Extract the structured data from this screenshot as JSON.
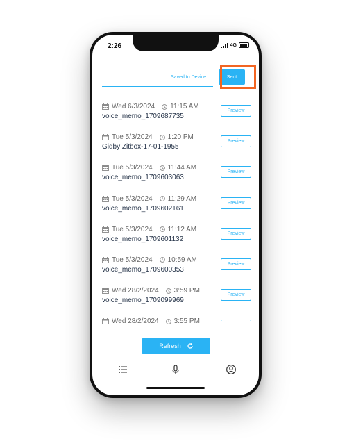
{
  "status": {
    "time": "2:26",
    "network": "4G"
  },
  "tabs": {
    "saved_label": "Saved to Device",
    "sent_label": "Sent"
  },
  "items": [
    {
      "date": "Wed 6/3/2024",
      "time": "11:15 AM",
      "name": "voice_memo_1709687735",
      "preview_label": "Preview"
    },
    {
      "date": "Tue 5/3/2024",
      "time": "1:20 PM",
      "name": "Gidby Zitbox-17-01-1955",
      "preview_label": "Preview"
    },
    {
      "date": "Tue 5/3/2024",
      "time": "11:44 AM",
      "name": "voice_memo_1709603063",
      "preview_label": "Preview"
    },
    {
      "date": "Tue 5/3/2024",
      "time": "11:29 AM",
      "name": "voice_memo_1709602161",
      "preview_label": "Preview"
    },
    {
      "date": "Tue 5/3/2024",
      "time": "11:12 AM",
      "name": "voice_memo_1709601132",
      "preview_label": "Preview"
    },
    {
      "date": "Tue 5/3/2024",
      "time": "10:59 AM",
      "name": "voice_memo_1709600353",
      "preview_label": "Preview"
    },
    {
      "date": "Wed 28/2/2024",
      "time": "3:59 PM",
      "name": "voice_memo_1709099969",
      "preview_label": "Preview"
    },
    {
      "date": "Wed 28/2/2024",
      "time": "3:55 PM",
      "name": "",
      "preview_label": ""
    }
  ],
  "refresh_label": "Refresh",
  "nav": {
    "icons": [
      "list-icon",
      "microphone-icon",
      "user-icon"
    ]
  },
  "colors": {
    "accent": "#2ab3f4",
    "highlight": "#f26522",
    "text_dark": "#263449",
    "text_muted": "#666666"
  }
}
